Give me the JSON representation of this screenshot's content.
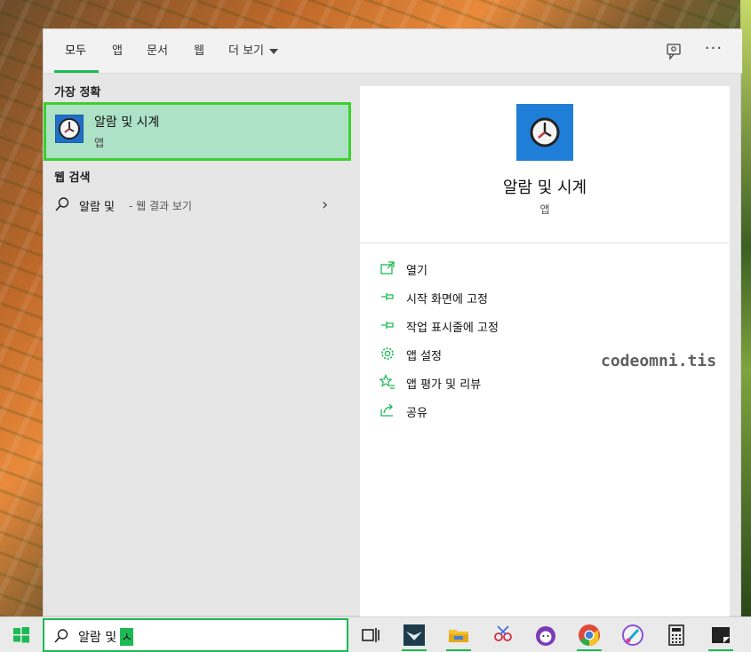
{
  "tabs": {
    "all": "모두",
    "apps": "앱",
    "documents": "문서",
    "web": "웹",
    "more": "더 보기"
  },
  "best_match": {
    "title": "가장 정확",
    "app_name": "알람 및 시계",
    "app_type": "앱"
  },
  "web_search": {
    "title": "웹 검색",
    "query": "알람 및",
    "suffix": "- 웹 결과 보기"
  },
  "preview": {
    "app_name": "알람 및 시계",
    "app_type": "앱",
    "actions": [
      {
        "label": "열기",
        "icon": "open-icon"
      },
      {
        "label": "시작 화면에 고정",
        "icon": "pin-icon"
      },
      {
        "label": "작업 표시줄에 고정",
        "icon": "pin-icon"
      },
      {
        "label": "앱 설정",
        "icon": "gear-icon"
      },
      {
        "label": "앱 평가 및 리뷰",
        "icon": "star-icon"
      },
      {
        "label": "공유",
        "icon": "share-icon"
      }
    ]
  },
  "watermark": "codeomni.tis",
  "taskbar": {
    "search_text": "알람 및",
    "search_composing": "ㅅ"
  },
  "colors": {
    "accent": "#1db954",
    "selection_bg": "#aee2c6",
    "selection_border": "#3ccf2e",
    "app_tile": "#1f7fd8"
  }
}
